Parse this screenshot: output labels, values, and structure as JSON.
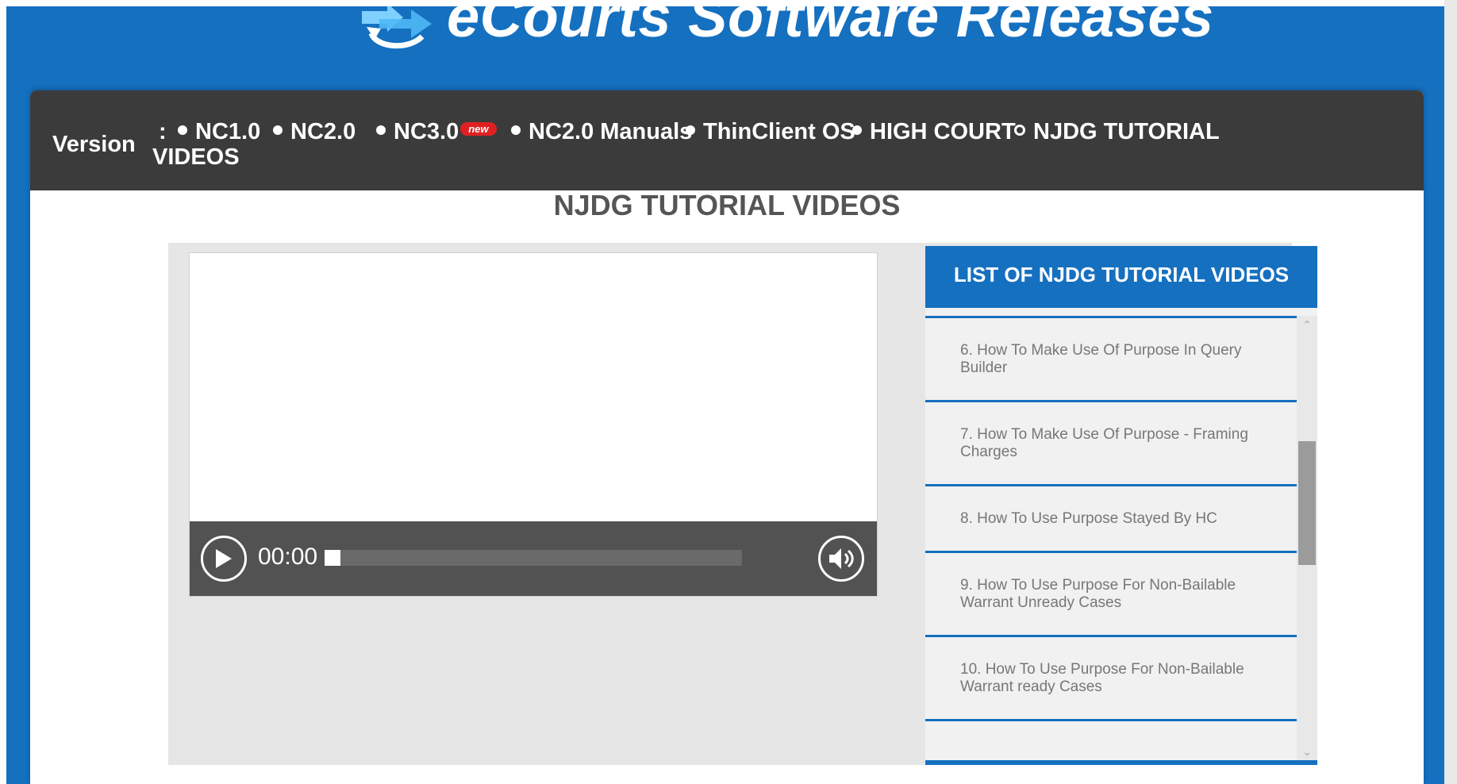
{
  "site": {
    "title": "eCourts Software Releases"
  },
  "nav": {
    "label": "Version",
    "separator": ":",
    "items": [
      {
        "label": "NC1.0",
        "dot": "filled"
      },
      {
        "label": "NC2.0",
        "dot": "filled"
      },
      {
        "label": "NC3.0",
        "dot": "filled",
        "badge": "new"
      },
      {
        "label": "NC2.0 Manuals",
        "dot": "filled"
      },
      {
        "label": "ThinClient OS",
        "dot": "filled"
      },
      {
        "label": "HIGH COURT",
        "dot": "filled"
      },
      {
        "label": "NJDG TUTORIAL",
        "dot": "open"
      }
    ],
    "wrap_text": "VIDEOS"
  },
  "page": {
    "heading": "NJDG TUTORIAL VIDEOS"
  },
  "player": {
    "time": "00:00",
    "progress": 0,
    "play_icon": "play-icon",
    "volume_icon": "volume-icon"
  },
  "playlist": {
    "header": "LIST OF NJDG TUTORIAL VIDEOS",
    "items": [
      "6. How To Make Use Of Purpose In Query Builder",
      "7. How To Make Use Of Purpose - Framing Charges",
      "8. How To Use Purpose Stayed By HC",
      "9. How To Use Purpose For Non-Bailable Warrant Unready Cases",
      "10. How To Use Purpose For Non-Bailable Warrant ready Cases"
    ]
  },
  "colors": {
    "brand_blue": "#1570c0",
    "navbar": "#3b3b3b",
    "controls": "#525252",
    "badge_red": "#e02020"
  }
}
